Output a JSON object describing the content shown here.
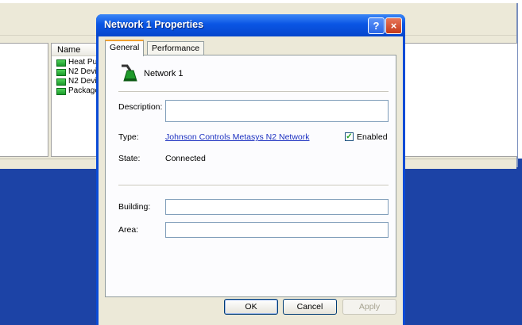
{
  "background_window": {
    "list": {
      "column_header": "Name",
      "items": [
        {
          "label": "Heat Pu"
        },
        {
          "label": "N2 Devi"
        },
        {
          "label": "N2 Devi"
        },
        {
          "label": "Package"
        }
      ]
    }
  },
  "dialog": {
    "title": "Network 1 Properties",
    "help_button": "?",
    "close_button": "×",
    "tabs": [
      {
        "label": "General",
        "active": true
      },
      {
        "label": "Performance",
        "active": false
      }
    ],
    "general": {
      "network_name": "Network 1",
      "description_label": "Description:",
      "description_value": "",
      "type_label": "Type:",
      "type_value": "Johnson Controls Metasys N2 Network",
      "enabled_label": "Enabled",
      "enabled_checked": true,
      "check_mark": "✓",
      "state_label": "State:",
      "state_value": "Connected",
      "building_label": "Building:",
      "building_value": "",
      "area_label": "Area:",
      "area_value": ""
    },
    "buttons": {
      "ok": "OK",
      "cancel": "Cancel",
      "apply": "Apply"
    }
  },
  "colors": {
    "desktop": "#1c43a6",
    "titlebar": "#0a55e4",
    "link": "#1b30c0"
  }
}
